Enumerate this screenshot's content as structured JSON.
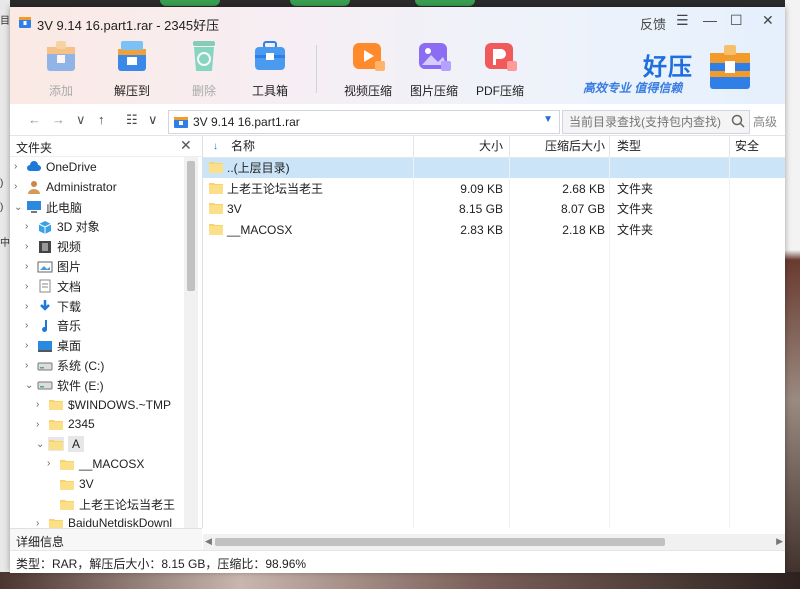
{
  "window": {
    "title": "3V 9.14 16.part1.rar - 2345好压",
    "feedback": "反馈",
    "menu_glyph": "☰",
    "minimize_glyph": "—",
    "maximize_glyph": "☐",
    "close_glyph": "✕"
  },
  "toolbar": {
    "left": [
      {
        "label": "添加",
        "icon": "add-archive-icon",
        "enabled": false
      },
      {
        "label": "解压到",
        "icon": "extract-to-icon",
        "enabled": true
      },
      {
        "label": "删除",
        "icon": "recycle-delete-icon",
        "enabled": false
      },
      {
        "label": "工具箱",
        "icon": "toolbox-icon",
        "enabled": true
      }
    ],
    "right": [
      {
        "label": "视频压缩",
        "icon": "video-compress-icon",
        "enabled": true
      },
      {
        "label": "图片压缩",
        "icon": "image-compress-icon",
        "enabled": true
      },
      {
        "label": "PDF压缩",
        "icon": "pdf-compress-icon",
        "enabled": true
      }
    ]
  },
  "brand": {
    "name": "好压",
    "slogan": "高效专业  值得信赖"
  },
  "nav": {
    "back": "←",
    "forward": "→",
    "down": "∨",
    "up": "↑",
    "view": "☷",
    "view_dd": "∨",
    "path": "3V 9.14 16.part1.rar",
    "search_placeholder": "当前目录查找(支持包内查找)",
    "advanced": "高级"
  },
  "tree": {
    "header": "文件夹",
    "close": "✕",
    "nodes": [
      {
        "label": "OneDrive",
        "icon": "cloud-icon",
        "chev": "›",
        "level": 0
      },
      {
        "label": "Administrator",
        "icon": "user-icon",
        "chev": "›",
        "level": 0
      },
      {
        "label": "此电脑",
        "icon": "computer-icon",
        "chev": "⌄",
        "level": 0
      },
      {
        "label": "3D 对象",
        "icon": "cube-icon",
        "chev": "›",
        "level": 1
      },
      {
        "label": "视频",
        "icon": "film-icon",
        "chev": "›",
        "level": 1
      },
      {
        "label": "图片",
        "icon": "picture-icon",
        "chev": "›",
        "level": 1
      },
      {
        "label": "文档",
        "icon": "document-icon",
        "chev": "›",
        "level": 1
      },
      {
        "label": "下载",
        "icon": "download-icon",
        "chev": "›",
        "level": 1
      },
      {
        "label": "音乐",
        "icon": "music-icon",
        "chev": "›",
        "level": 1
      },
      {
        "label": "桌面",
        "icon": "desktop-icon",
        "chev": "›",
        "level": 1
      },
      {
        "label": "系统 (C:)",
        "icon": "drive-icon",
        "chev": "›",
        "level": 1
      },
      {
        "label": "软件 (E:)",
        "icon": "drive-icon",
        "chev": "⌄",
        "level": 1
      },
      {
        "label": "$WINDOWS.~TMP",
        "icon": "folder-icon",
        "chev": "›",
        "level": 2
      },
      {
        "label": "2345",
        "icon": "folder-icon",
        "chev": "›",
        "level": 2
      },
      {
        "label": "A",
        "icon": "folder-icon",
        "chev": "⌄",
        "level": 2,
        "selected": true
      },
      {
        "label": "__MACOSX",
        "icon": "folder-icon",
        "chev": "›",
        "level": 3
      },
      {
        "label": "3V",
        "icon": "folder-icon",
        "chev": "",
        "level": 3
      },
      {
        "label": "上老王论坛当老王",
        "icon": "folder-icon",
        "chev": "",
        "level": 3
      },
      {
        "label": "BaiduNetdiskDownl",
        "icon": "folder-icon",
        "chev": "›",
        "level": 2
      }
    ],
    "detail": "详细信息"
  },
  "list": {
    "columns": {
      "name": "名称",
      "size": "大小",
      "packed": "压缩后大小",
      "type": "类型",
      "security": "安全"
    },
    "sort_arrow": "↓",
    "rows": [
      {
        "name": "..(上层目录)",
        "size": "",
        "packed": "",
        "type": "",
        "selected": true
      },
      {
        "name": "上老王论坛当老王",
        "size": "9.09 KB",
        "packed": "2.68 KB",
        "type": "文件夹",
        "selected": false
      },
      {
        "name": "3V",
        "size": "8.15 GB",
        "packed": "8.07 GB",
        "type": "文件夹",
        "selected": false
      },
      {
        "name": "__MACOSX",
        "size": "2.83 KB",
        "packed": "2.18 KB",
        "type": "文件夹",
        "selected": false
      }
    ]
  },
  "status": {
    "text": "类型：RAR，解压后大小：8.15 GB，压缩比：98.96%"
  },
  "background": {
    "left_chars": [
      "目",
      ")",
      ")",
      "中"
    ]
  },
  "colors": {
    "accent": "#1e6ee0",
    "selection": "#cce4f7",
    "folder": "#f7d36a"
  }
}
